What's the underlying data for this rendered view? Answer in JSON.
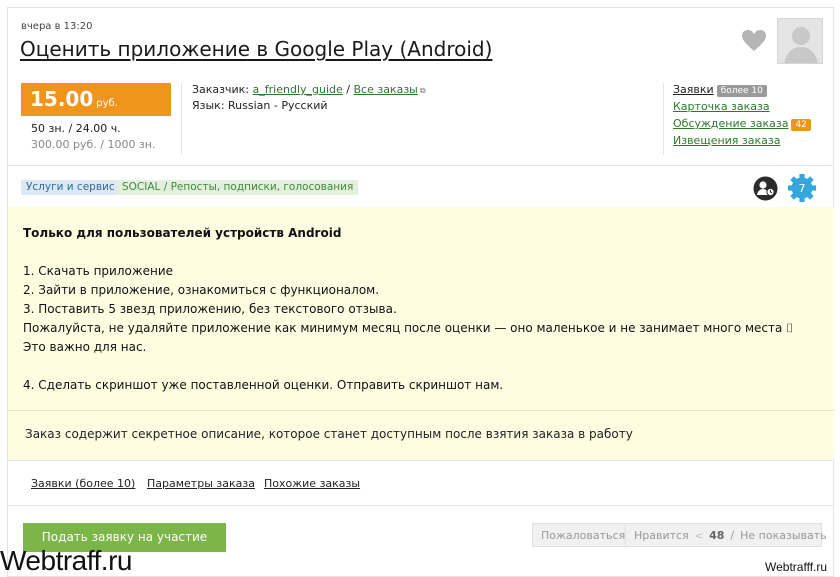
{
  "header": {
    "posted": "вчера в 13:20",
    "title": "Оценить приложение в Google Play (Android)"
  },
  "price": {
    "value": "15.00",
    "currency": "руб.",
    "line1": "50 зн.  / 24.00 ч.",
    "line2": "300.00 руб.  / 1000 зн."
  },
  "client": {
    "label": "Заказчик: ",
    "name": "a_friendly_guide",
    "sep": " / ",
    "all_orders": "Все заказы",
    "lang_label": "Язык: ",
    "lang_value": "Russian - Русский"
  },
  "right_links": {
    "requests": "Заявки",
    "requests_badge": "более 10",
    "order_card": "Карточка заказа",
    "discussion": "Обсуждение заказа",
    "discussion_badge": "42",
    "notices": "Извещения заказа"
  },
  "tags": {
    "tag1": "Услуги и сервис",
    "tag2": "SOCIAL / Репосты, подписки, голосования"
  },
  "level_badge": "7",
  "description": {
    "heading": "Только для пользователей устройств Android",
    "line1": "1. Скачать приложение",
    "line2": "2. Зайти в приложение, ознакомиться с функционалом.",
    "line3": "3. Поставить 5 звезд приложению, без текстового отзыва.",
    "line4": "Пожалуйста, не удаляйте приложение как минимум месяц после оценки — оно маленькое и не занимает много места ⌷ Это важно для нас.",
    "line5": "4. Сделать скриншот уже поставленной оценки. Отправить скриншот нам."
  },
  "secret_note": "Заказ содержит секретное описание, которое станет доступным после взятия заказа в работу",
  "bottom_tabs": {
    "requests": "Заявки (более 10)",
    "params": "Параметры заказа",
    "similar": "Похожие заказы"
  },
  "actions": {
    "apply": "Подать заявку на участие",
    "complain": "Пожаловаться",
    "like": "Нравится",
    "like_count": "48",
    "hide": "Не показывать"
  },
  "watermarks": {
    "left": "Webtraff.ru",
    "right": "Webtrafff.ru"
  },
  "colors": {
    "price_bg": "#f0941c",
    "apply_bg": "#7cb548",
    "description_bg": "#fffde1",
    "link": "#2a7a2a"
  }
}
